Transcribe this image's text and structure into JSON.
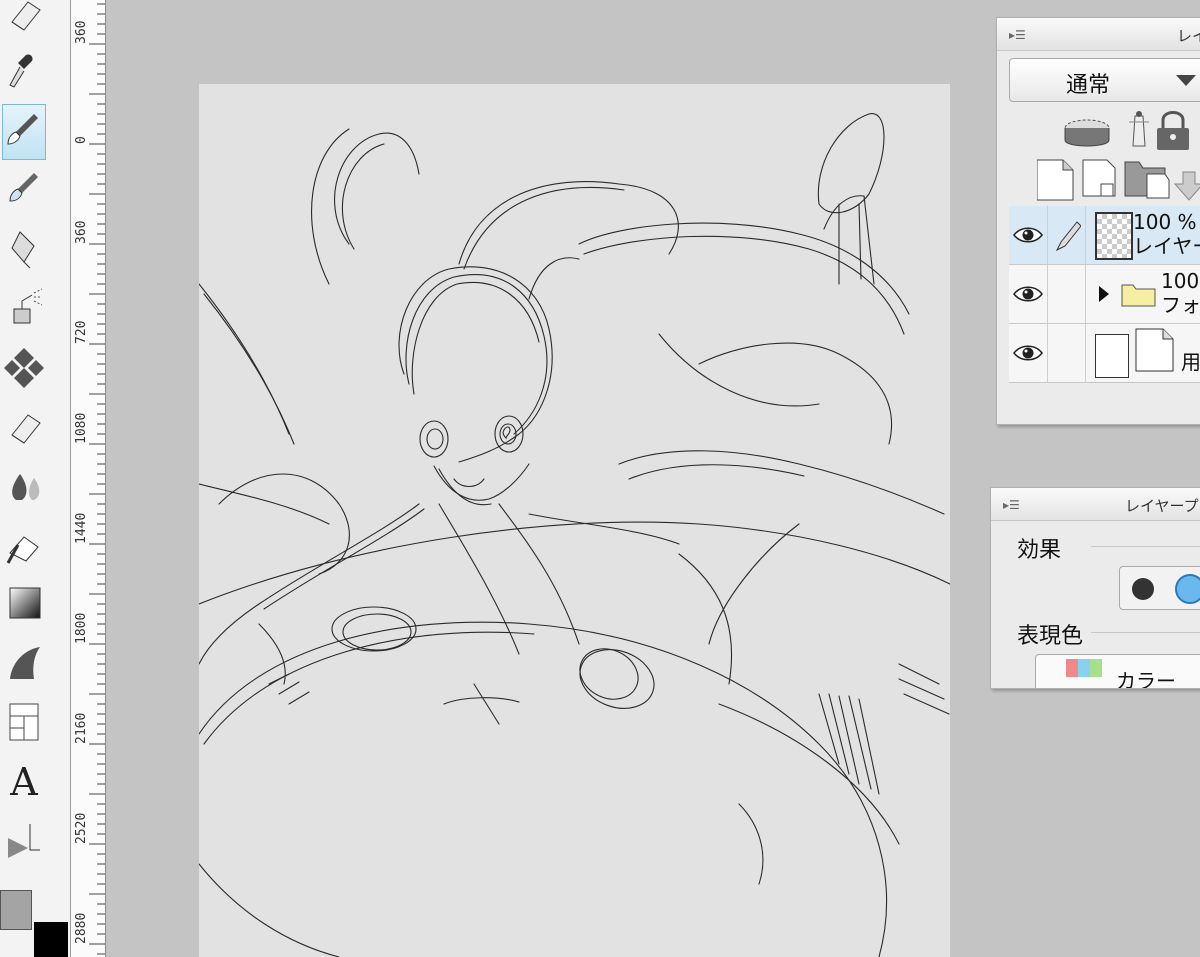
{
  "ruler": {
    "labels": [
      "360",
      "0",
      "360",
      "720",
      "1080",
      "1440",
      "1800",
      "2160",
      "2520",
      "2880"
    ]
  },
  "tools": [
    {
      "name": "eraser-top-tool",
      "icon": "eraser-icon"
    },
    {
      "name": "eyedropper-tool",
      "icon": "eyedropper-icon"
    },
    {
      "name": "brush-tool",
      "icon": "brush-icon",
      "active": true
    },
    {
      "name": "watercolor-brush-tool",
      "icon": "watercolor-brush-icon"
    },
    {
      "name": "pen-tool",
      "icon": "pen-icon"
    },
    {
      "name": "airbrush-tool",
      "icon": "airbrush-icon"
    },
    {
      "name": "decoration-tool",
      "icon": "decoration-icon"
    },
    {
      "name": "eraser-tool",
      "icon": "eraser-icon"
    },
    {
      "name": "blend-tool",
      "icon": "blend-icon"
    },
    {
      "name": "fill-tool",
      "icon": "bucket-icon"
    },
    {
      "name": "gradient-tool",
      "icon": "gradient-icon"
    },
    {
      "name": "figure-tool",
      "icon": "figure-icon"
    },
    {
      "name": "frame-border-tool",
      "icon": "frame-icon"
    },
    {
      "name": "text-tool",
      "icon": "text-icon",
      "glyph": "A"
    },
    {
      "name": "operation-tool",
      "icon": "operation-icon"
    }
  ],
  "colors": {
    "main": "#a4a4a4",
    "sub": "#000000",
    "canvas": "#e2e2e2",
    "workspace": "#c4c4c4",
    "active_tool": "#bfe3f3"
  },
  "layer_panel": {
    "title": "レイ",
    "blend_mode": "通常",
    "layers": [
      {
        "opacity": "100 %",
        "name": "レイヤー",
        "type": "raster",
        "visible": true,
        "selected": true
      },
      {
        "opacity": "100",
        "name": "フォ",
        "type": "folder",
        "visible": true
      },
      {
        "opacity": "",
        "name": "用",
        "type": "paper",
        "visible": true
      }
    ]
  },
  "property_panel": {
    "title": "レイヤープ",
    "effect_label": "効果",
    "color_label": "表現色",
    "color_value": "カラー"
  }
}
